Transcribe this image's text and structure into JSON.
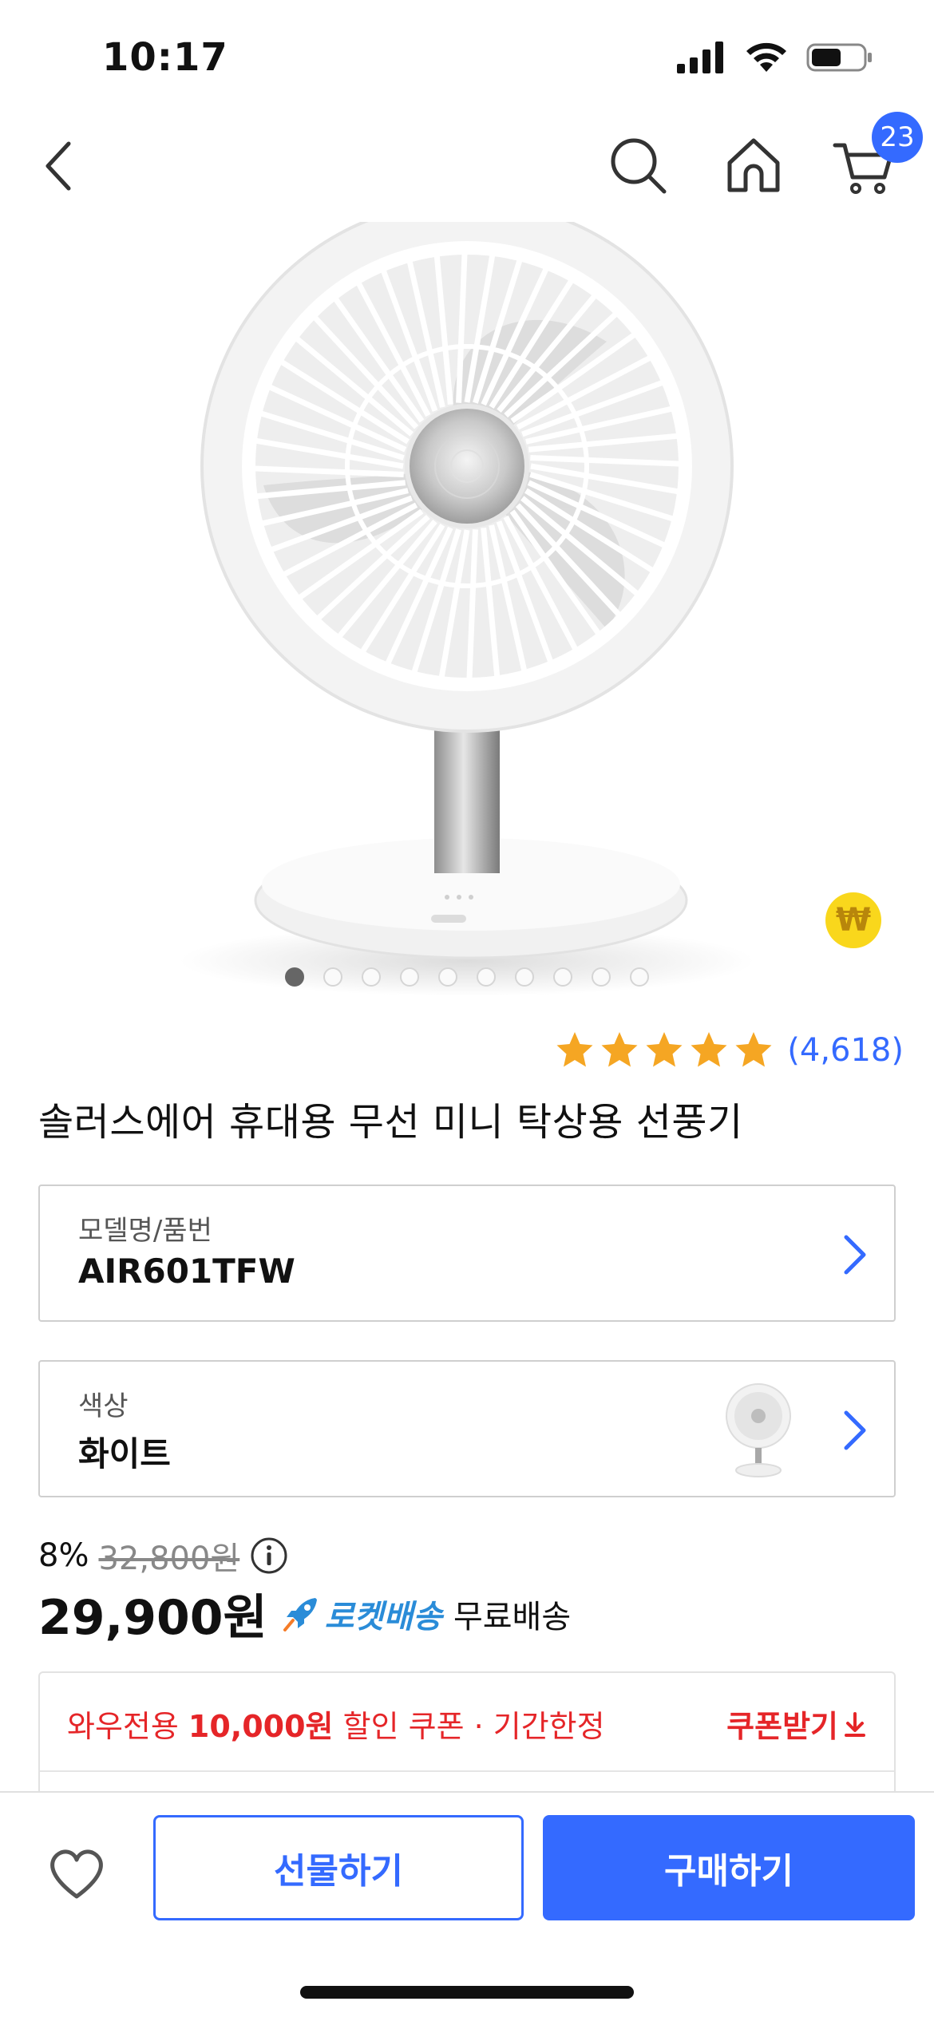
{
  "status_bar": {
    "time": "10:17"
  },
  "nav": {
    "cart_count": "23"
  },
  "product": {
    "rating_count": "(4,618)",
    "rating_stars": 5,
    "title": "솔러스에어 휴대용 무선 미니 탁상용 선풍기",
    "image_count": 10,
    "image_active_index": 0
  },
  "options": {
    "model": {
      "label": "모델명/품번",
      "value": "AIR601TFW"
    },
    "color": {
      "label": "색상",
      "value": "화이트"
    }
  },
  "price": {
    "discount_rate": "8%",
    "original_price": "32,800원",
    "sale_price": "29,900원",
    "rocket_label": "로켓배송",
    "shipping": "무료배송"
  },
  "coupon": {
    "text_prefix": "와우전용 ",
    "amount": "10,000원",
    "text_suffix": " 할인 쿠폰 · 기간한정",
    "button_label": "쿠폰받기"
  },
  "bottom_bar": {
    "gift_label": "선물하기",
    "buy_label": "구매하기"
  },
  "colors": {
    "accent": "#346aff",
    "coupon_red": "#e52528",
    "star": "#f5a623",
    "rocket": "#2a8cd8"
  }
}
